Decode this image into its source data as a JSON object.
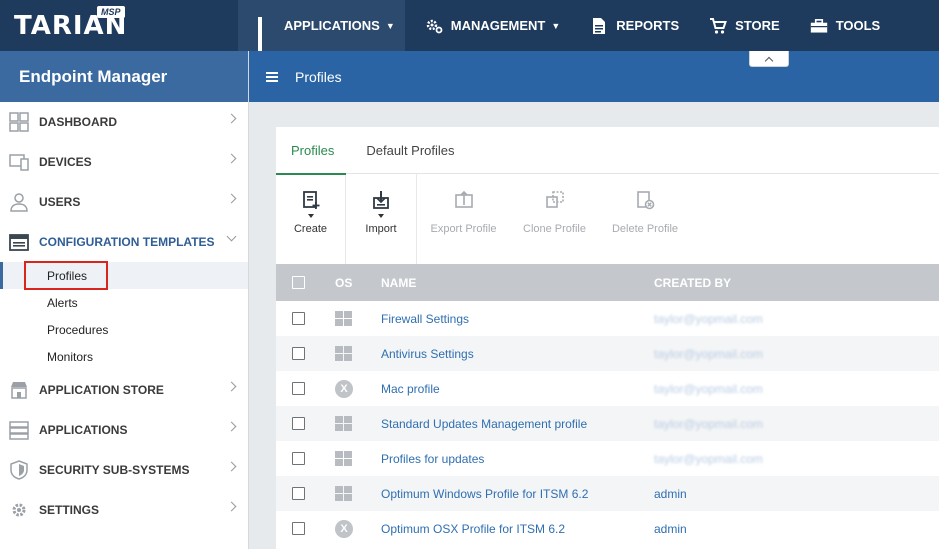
{
  "brand": {
    "name": "TARIAN",
    "badge": "MSP"
  },
  "topnav": [
    {
      "label": "APPLICATIONS",
      "icon": "apps-grid-icon",
      "has_caret": true,
      "active": true
    },
    {
      "label": "MANAGEMENT",
      "icon": "gears-icon",
      "has_caret": true
    },
    {
      "label": "REPORTS",
      "icon": "report-icon"
    },
    {
      "label": "STORE",
      "icon": "cart-icon"
    },
    {
      "label": "TOOLS",
      "icon": "toolbox-icon"
    }
  ],
  "sidebar": {
    "title": "Endpoint Manager",
    "items": [
      {
        "label": "DASHBOARD",
        "icon": "dashboard-icon"
      },
      {
        "label": "DEVICES",
        "icon": "devices-icon"
      },
      {
        "label": "USERS",
        "icon": "user-icon"
      },
      {
        "label": "CONFIGURATION TEMPLATES",
        "icon": "template-icon",
        "open": true
      },
      {
        "label": "APPLICATION STORE",
        "icon": "store-icon"
      },
      {
        "label": "APPLICATIONS",
        "icon": "applications-icon"
      },
      {
        "label": "SECURITY SUB-SYSTEMS",
        "icon": "shield-icon"
      },
      {
        "label": "SETTINGS",
        "icon": "gear-icon"
      }
    ],
    "subitems": [
      {
        "label": "Profiles",
        "active": true
      },
      {
        "label": "Alerts"
      },
      {
        "label": "Procedures"
      },
      {
        "label": "Monitors"
      }
    ]
  },
  "header": {
    "title": "Profiles"
  },
  "tabs": [
    {
      "label": "Profiles",
      "active": true
    },
    {
      "label": "Default Profiles"
    }
  ],
  "toolbar": [
    {
      "label": "Create",
      "icon": "create-profile-icon",
      "enabled": true,
      "caret": true
    },
    {
      "label": "Import",
      "icon": "import-icon",
      "enabled": true,
      "caret": true
    },
    {
      "label": "Export Profile",
      "icon": "export-icon",
      "enabled": false
    },
    {
      "label": "Clone Profile",
      "icon": "clone-icon",
      "enabled": false
    },
    {
      "label": "Delete Profile",
      "icon": "delete-profile-icon",
      "enabled": false
    }
  ],
  "table": {
    "columns": {
      "os": "OS",
      "name": "NAME",
      "created_by": "CREATED BY"
    },
    "rows": [
      {
        "os": "windows",
        "name": "Firewall Settings",
        "created_by": "taylor@yopmail.com",
        "blurred": true
      },
      {
        "os": "windows",
        "name": "Antivirus Settings",
        "created_by": "taylor@yopmail.com",
        "blurred": true
      },
      {
        "os": "mac",
        "name": "Mac profile",
        "created_by": "taylor@yopmail.com",
        "blurred": true
      },
      {
        "os": "windows",
        "name": "Standard Updates Management profile",
        "created_by": "taylor@yopmail.com",
        "blurred": true
      },
      {
        "os": "windows",
        "name": "Profiles for updates",
        "created_by": "taylor@yopmail.com",
        "blurred": true
      },
      {
        "os": "windows",
        "name": "Optimum Windows Profile for ITSM 6.2",
        "created_by": "admin"
      },
      {
        "os": "mac",
        "name": "Optimum OSX Profile for ITSM 6.2",
        "created_by": "admin"
      }
    ]
  }
}
